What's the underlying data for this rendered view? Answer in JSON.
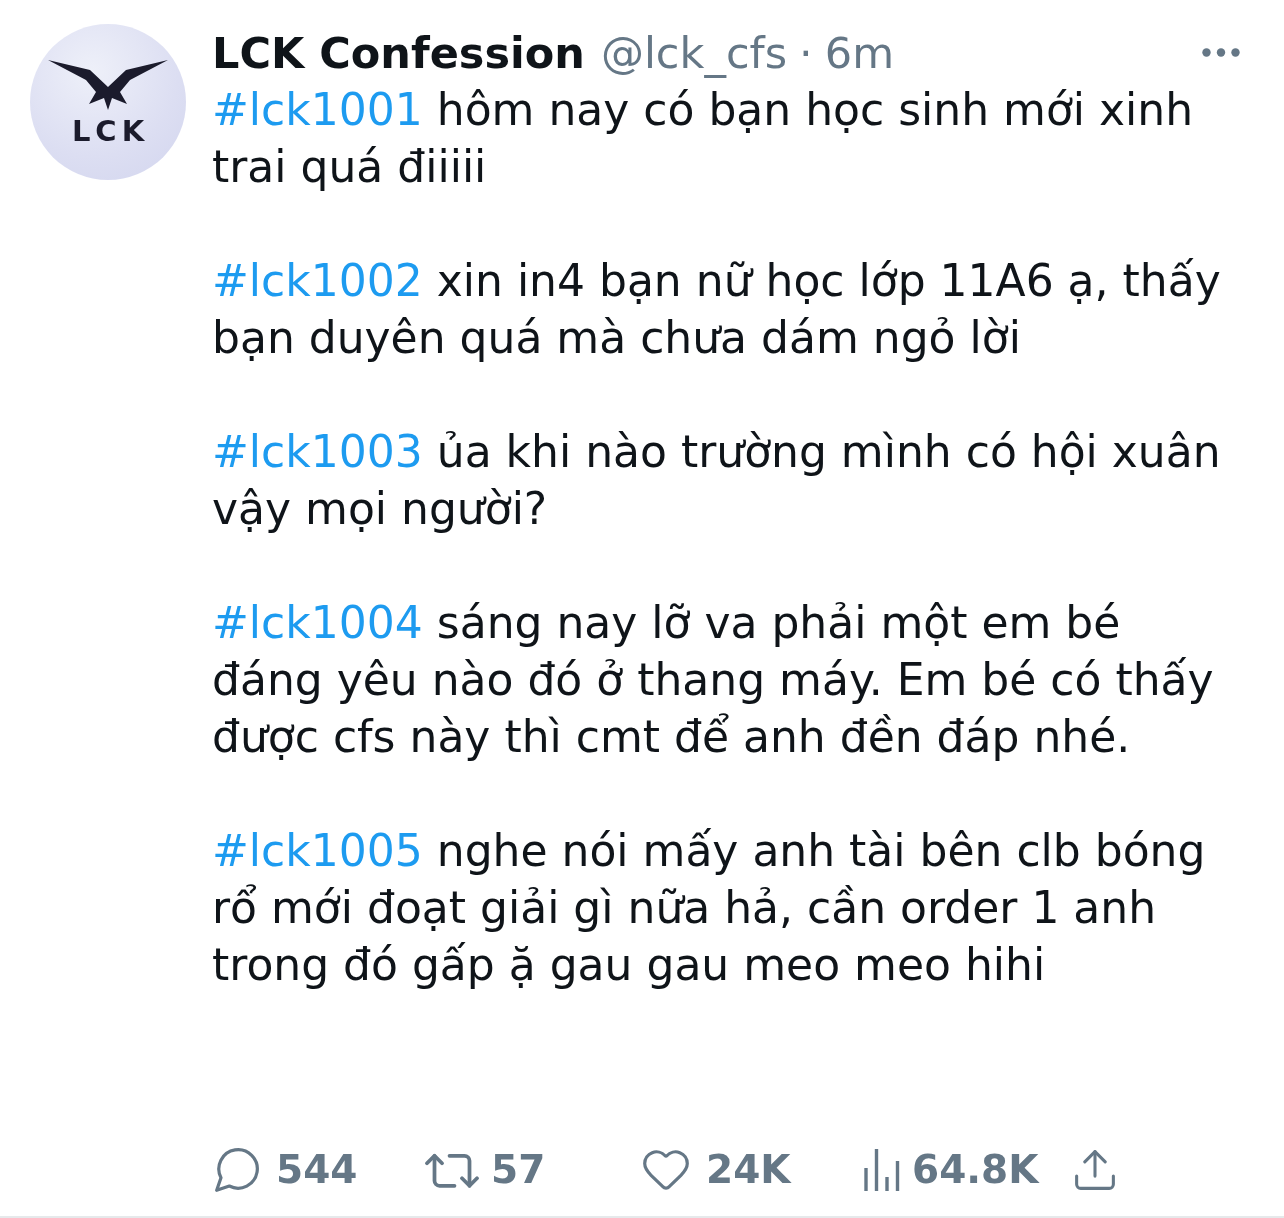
{
  "author": {
    "name": "LCK Confession",
    "handle": "@lck_cfs",
    "separator": "·",
    "time": "6m",
    "avatar_text": "LCK"
  },
  "paragraphs": [
    {
      "hashtag": "#lck1001",
      "text": "hôm nay có bạn học sinh mới xinh trai quá điiiii"
    },
    {
      "hashtag": "#lck1002",
      "text": "xin in4 bạn nữ học lớp 11A6 ạ, thấy bạn duyên quá mà chưa dám ngỏ lời"
    },
    {
      "hashtag": "#lck1003",
      "text": "ủa khi nào trường mình có hội xuân vậy mọi người?"
    },
    {
      "hashtag": "#lck1004",
      "text": "sáng nay lỡ va phải một em bé đáng yêu nào đó ở thang máy. Em bé có thấy được cfs này thì cmt để anh đền đáp nhé."
    },
    {
      "hashtag": "#lck1005",
      "text": "nghe nói mấy anh tài bên clb bóng rổ mới đoạt giải gì nữa hả, cần order 1 anh trong đó gấp ặ gau gau meo meo hihi"
    }
  ],
  "actions": [
    {
      "kind": "reply",
      "count": "544"
    },
    {
      "kind": "repost",
      "count": "57"
    },
    {
      "kind": "like",
      "count": "24K"
    },
    {
      "kind": "views",
      "count": "64.8K"
    },
    {
      "kind": "share"
    }
  ]
}
